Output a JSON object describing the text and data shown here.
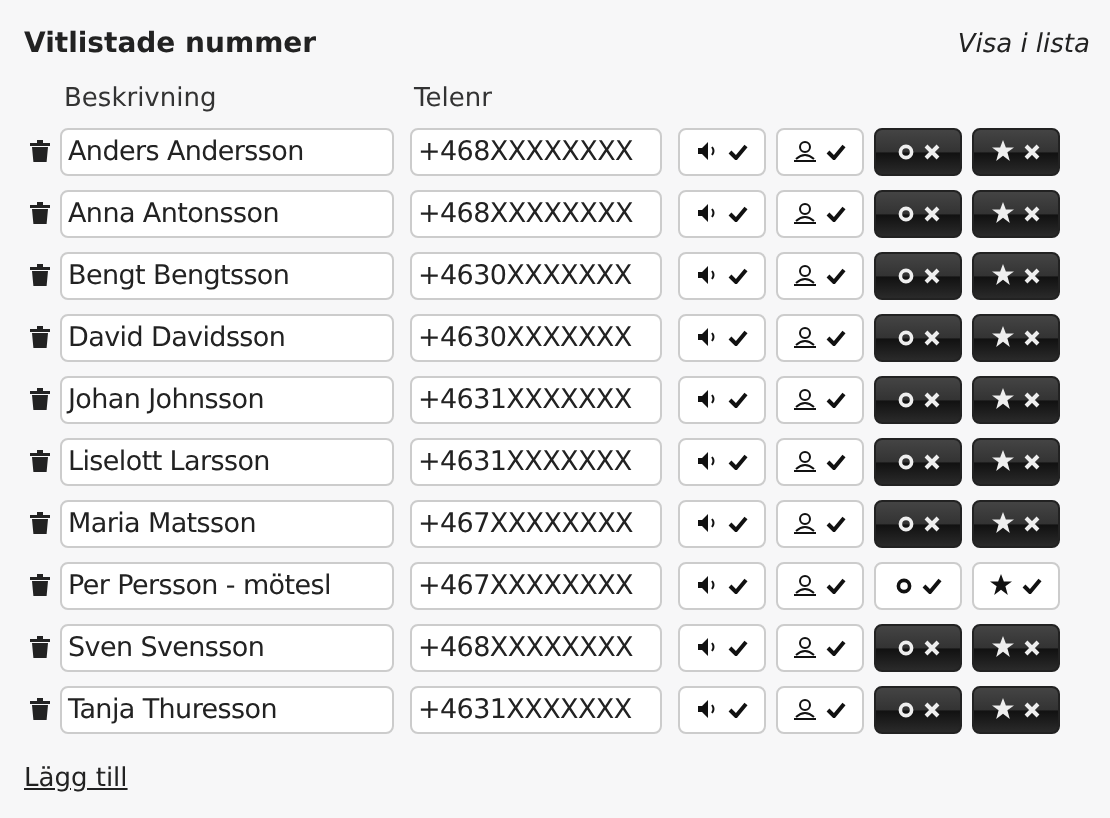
{
  "title": "Vitlistade nummer",
  "view_link": "Visa i lista",
  "columns": [
    "Beskrivning",
    "Telenr"
  ],
  "rows": [
    {
      "name": "Anders Andersson",
      "phone": "+468XXXXXXXX",
      "sound": true,
      "user": true,
      "circle": false,
      "star": false
    },
    {
      "name": "Anna Antonsson",
      "phone": "+468XXXXXXXX",
      "sound": true,
      "user": true,
      "circle": false,
      "star": false
    },
    {
      "name": "Bengt Bengtsson",
      "phone": "+4630XXXXXXX",
      "sound": true,
      "user": true,
      "circle": false,
      "star": false
    },
    {
      "name": "David Davidsson",
      "phone": "+4630XXXXXXX",
      "sound": true,
      "user": true,
      "circle": false,
      "star": false
    },
    {
      "name": "Johan Johnsson",
      "phone": "+4631XXXXXXX",
      "sound": true,
      "user": true,
      "circle": false,
      "star": false
    },
    {
      "name": "Liselott Larsson",
      "phone": "+4631XXXXXXX",
      "sound": true,
      "user": true,
      "circle": false,
      "star": false
    },
    {
      "name": "Maria Matsson",
      "phone": "+467XXXXXXXX",
      "sound": true,
      "user": true,
      "circle": false,
      "star": false
    },
    {
      "name": "Per Persson - mötesl",
      "phone": "+467XXXXXXXX",
      "sound": true,
      "user": true,
      "circle": true,
      "star": true
    },
    {
      "name": "Sven Svensson",
      "phone": "+468XXXXXXXX",
      "sound": true,
      "user": true,
      "circle": false,
      "star": false
    },
    {
      "name": "Tanja Thuresson",
      "phone": "+4631XXXXXXX",
      "sound": true,
      "user": true,
      "circle": false,
      "star": false
    }
  ],
  "add_link": "Lägg till"
}
